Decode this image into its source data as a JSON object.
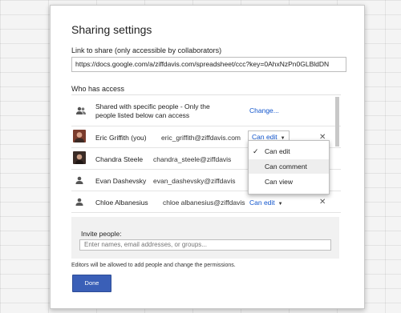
{
  "dialog": {
    "title": "Sharing settings",
    "link_label": "Link to share (only accessible by collaborators)",
    "link_value": "https://docs.google.com/a/ziffdavis.com/spreadsheet/ccc?key=0AhxNzPn0GLBldDN",
    "who_label": "Who has access"
  },
  "access": {
    "group_line1": "Shared with specific people - Only the",
    "group_line2": "people listed below can access",
    "change_label": "Change...",
    "people": [
      {
        "name": "Eric Griffith (you)",
        "email": "eric_griffith@ziffdavis.com",
        "permission": "Can edit",
        "remove": "✕",
        "avatar_color": "#7a3b2c"
      },
      {
        "name": "Chandra Steele",
        "email": "chandra_steele@ziffdavis",
        "avatar_color": "#3a2b26"
      },
      {
        "name": "Evan Dashevsky",
        "email": "evan_dashevsky@ziffdavis"
      },
      {
        "name": "Chloe Albanesius",
        "email": "chloe albanesius@ziffdavis",
        "permission": "Can edit",
        "remove": "✕"
      }
    ]
  },
  "dropdown": {
    "check": "✓",
    "options": [
      "Can edit",
      "Can comment",
      "Can view"
    ],
    "selected": "Can edit",
    "highlighted": "Can comment"
  },
  "invite": {
    "label": "Invite people:",
    "placeholder": "Enter names, email addresses, or groups..."
  },
  "footer": {
    "note": "Editors will be allowed to add people and change the permissions.",
    "done_label": "Done"
  },
  "colors": {
    "link": "#1155cc",
    "done_button": "#3a5fb7"
  },
  "icons": {
    "group": "group-people-icon",
    "person": "person-icon",
    "caret": "caret-down-icon",
    "remove": "close-icon",
    "check": "checkmark-icon"
  }
}
